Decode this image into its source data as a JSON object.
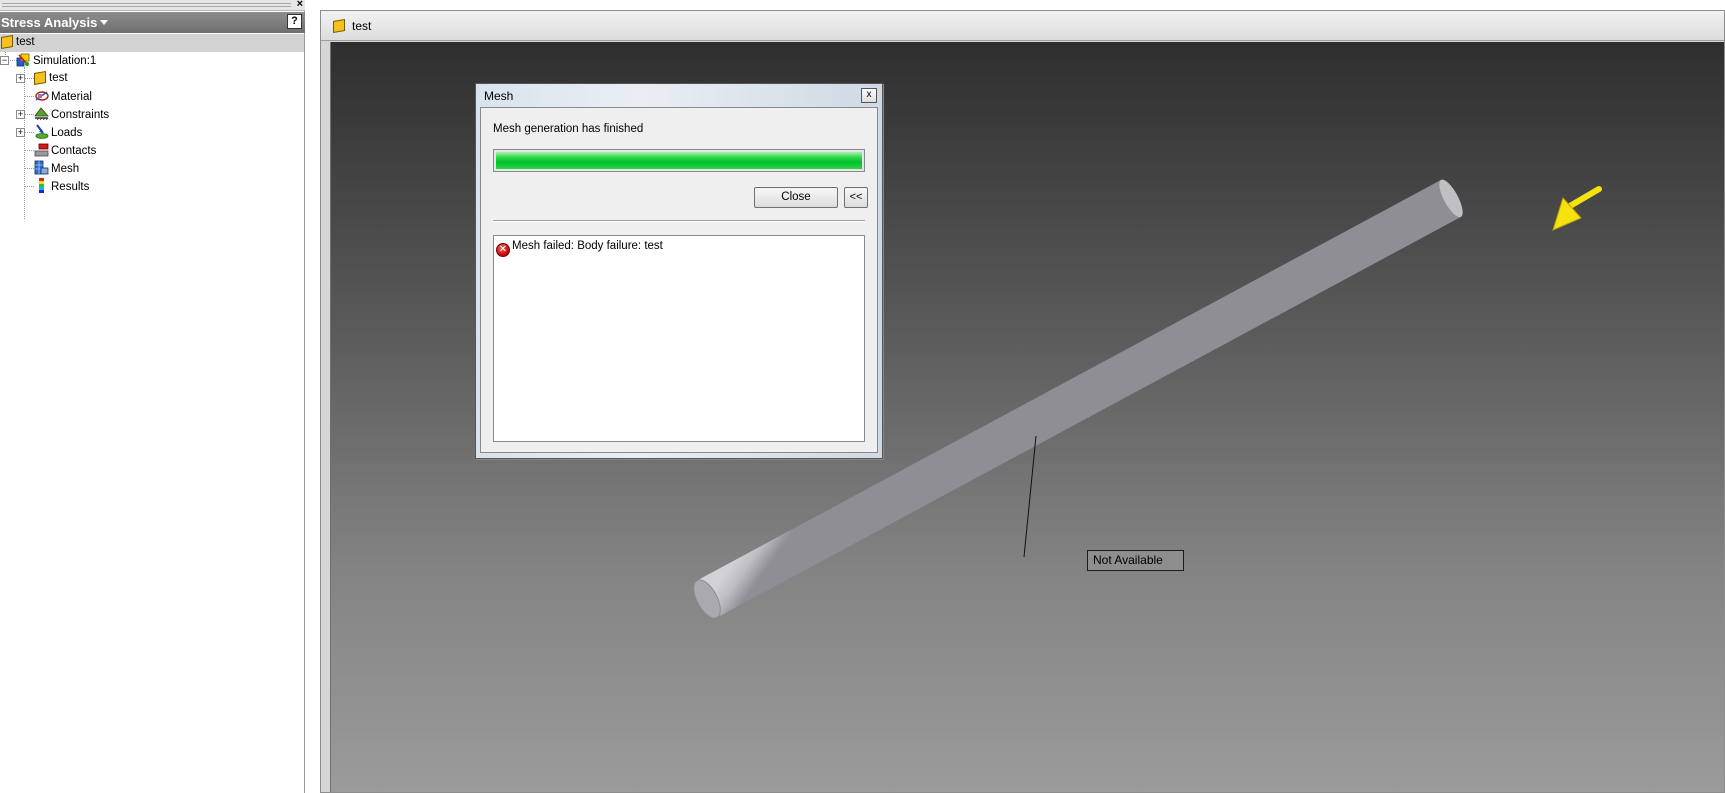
{
  "browser": {
    "close_label": "×",
    "panel_title": "Stress Analysis",
    "help_label": "?",
    "tree": {
      "root": "test",
      "simulation": "Simulation:1",
      "items": [
        {
          "label": "test",
          "icon": "part-icon",
          "expandable": true
        },
        {
          "label": "Material",
          "icon": "material-icon",
          "expandable": false
        },
        {
          "label": "Constraints",
          "icon": "constraints-icon",
          "expandable": true
        },
        {
          "label": "Loads",
          "icon": "loads-icon",
          "expandable": true
        },
        {
          "label": "Contacts",
          "icon": "contacts-icon",
          "expandable": false
        },
        {
          "label": "Mesh",
          "icon": "mesh-icon",
          "expandable": false
        },
        {
          "label": "Results",
          "icon": "results-icon",
          "expandable": false
        }
      ]
    }
  },
  "graphics": {
    "title": "test",
    "annotation": "Not Available"
  },
  "dialog": {
    "title": "Mesh",
    "close_x": "x",
    "status": "Mesh generation has finished",
    "progress_percent": 100,
    "close_label": "Close",
    "collapse_label": "<<",
    "log": [
      {
        "type": "error",
        "text": "Mesh failed: Body failure: test"
      }
    ]
  },
  "colors": {
    "progress": "#00c12a",
    "load_arrow": "#f5e20f",
    "panel_header": "#7d7d7d",
    "error": "#c40000"
  }
}
